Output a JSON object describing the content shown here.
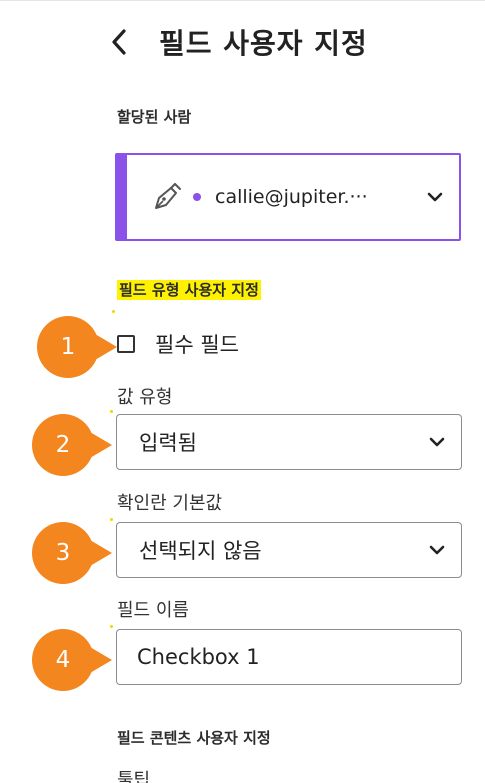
{
  "header": {
    "title": "필드 사용자 지정"
  },
  "assignee": {
    "label": "할당된 사람",
    "email": "callie@jupiter.···"
  },
  "field_type_section": {
    "label": "필드 유형 사용자 지정"
  },
  "required": {
    "label": "필수 필드",
    "checked": false
  },
  "value_type": {
    "label": "값 유형",
    "value": "입력됨"
  },
  "checkbox_default": {
    "label": "확인란 기본값",
    "value": "선택되지 않음"
  },
  "field_name": {
    "label": "필드 이름",
    "value": "Checkbox 1"
  },
  "content_section": {
    "label": "필드 콘텐츠 사용자 지정"
  },
  "partial_bottom_label": "툴팁",
  "callouts": [
    "1",
    "2",
    "3",
    "4"
  ],
  "colors": {
    "accent": "#8a52e8",
    "callout": "#f4861f",
    "highlight": "#fff200"
  }
}
